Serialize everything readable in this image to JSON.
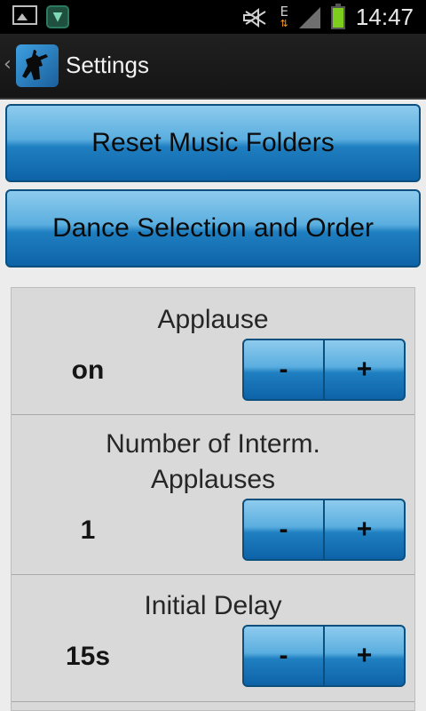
{
  "status_bar": {
    "time": "14:47",
    "network_type": "E",
    "icons": [
      "gallery-icon",
      "shield-app-icon",
      "mute-icon",
      "edge-data-icon",
      "signal-icon",
      "battery-icon"
    ]
  },
  "action_bar": {
    "title": "Settings",
    "logo_icon": "dancer-logo-icon"
  },
  "buttons": {
    "reset_music_folders": "Reset Music Folders",
    "dance_selection": "Dance Selection and Order"
  },
  "settings": [
    {
      "title": "Applause",
      "value": "on"
    },
    {
      "title": "Number of Interm.",
      "title_line2": "Applauses",
      "value": "1"
    },
    {
      "title": "Initial Delay",
      "value": "15s"
    }
  ],
  "stepper": {
    "minus_label": "-",
    "plus_label": "+"
  },
  "colors": {
    "button_top": "#8ecbee",
    "button_bottom": "#0e63a8",
    "button_border": "#0b4f7f",
    "battery": "#7ccd1e",
    "actionbar": "#1a1a1a"
  }
}
